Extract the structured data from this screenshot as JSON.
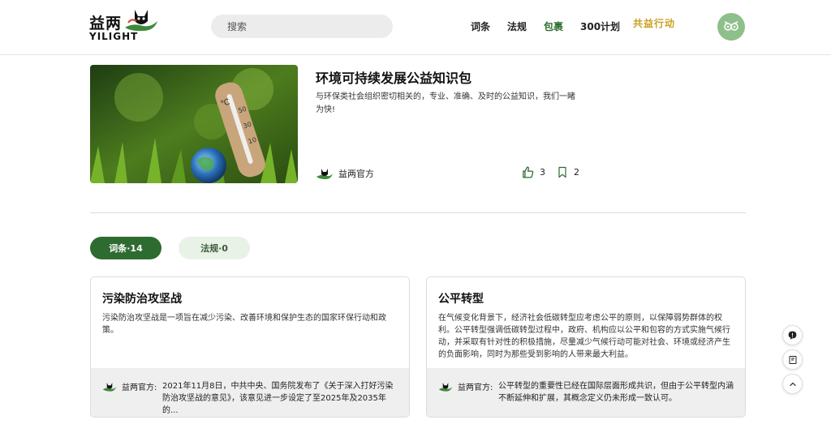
{
  "header": {
    "logo_cn": "益两",
    "logo_en": "YILIGHT",
    "search_placeholder": "搜索",
    "nav": [
      {
        "label": "词条",
        "active": false
      },
      {
        "label": "法规",
        "active": false
      },
      {
        "label": "包裹",
        "active": true
      },
      {
        "label": "300计划",
        "active": false
      }
    ],
    "nav_art": "共益行动"
  },
  "pack": {
    "title": "环境可持续发展公益知识包",
    "description": "与环保类社会组织密切相关的，专业、准确、及时的公益知识，我们一睹为快!",
    "author": "益两官方",
    "likes": "3",
    "bookmarks": "2"
  },
  "tabs": [
    {
      "label": "词条·14",
      "active": true
    },
    {
      "label": "法规·0",
      "active": false
    }
  ],
  "cards": [
    {
      "title": "污染防治攻坚战",
      "body": "污染防治攻坚战是一项旨在减少污染、改善环境和保护生态的国家环保行动和政策。",
      "author": "益两官方:",
      "note": "2021年11月8日，中共中央、国务院发布了《关于深入打好污染防治攻坚战的意见》，该意见进一步设定了至2025年及2035年的..."
    },
    {
      "title": "公平转型",
      "body": "在气候变化背景下，经济社会低碳转型应考虑公平的原则，以保障弱势群体的权利。公平转型强调低碳转型过程中，政府、机构应以公平和包容的方式实施气候行动，并采取有针对性的积极措施，尽量减少气候行动可能对社会、环境或经济产生的负面影响，同时为那些受到影响的人带来最大利益。",
      "author": "益两官方:",
      "note": "公平转型的重要性已经在国际层面形成共识，但由于公平转型内涵不断延伸和扩展，其概念定义仍未形成一致认可。"
    }
  ],
  "icons": {
    "like": "thumbs-up-icon",
    "bookmark": "bookmark-icon",
    "chat": "chat-icon",
    "book": "book-icon",
    "top": "chevron-up-icon"
  },
  "colors": {
    "accent": "#2e6b30",
    "tab_inactive_bg": "#e8f2e6",
    "footer_bg": "#efefef"
  }
}
